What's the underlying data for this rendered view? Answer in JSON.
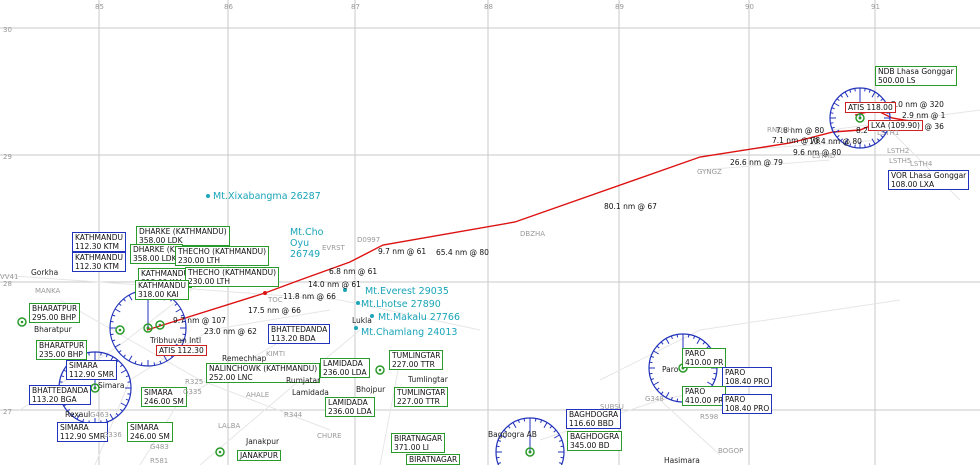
{
  "grid": {
    "lon": [
      "85",
      "86",
      "87",
      "88",
      "89",
      "90",
      "91"
    ],
    "lat": [
      "30",
      "29",
      "28",
      "27"
    ]
  },
  "route_legs": [
    "80.1 nm @ 67",
    "65.4 nm @ 80",
    "26.6 nm @ 79",
    "9.7 nm @ 61",
    "6.8 nm @ 61",
    "14.0 nm @ 61",
    "11.8 nm @ 66",
    "17.5 nm @ 66",
    "9.7 nm @ 107",
    "23.0 nm @ 62",
    "7.1 nm @ 78",
    "7.8 nm @ 80",
    "9.6 nm @ 80",
    "10.4 nm @ 80",
    "8.2",
    "3.0 nm @ 320",
    "2.9 nm @ 1",
    "nm @ 36"
  ],
  "peaks": [
    {
      "name": "Mt.Xixabangma 26287"
    },
    {
      "name": "Mt.Cho\nOyu\n26749"
    },
    {
      "name": "Mt.Everest 29035"
    },
    {
      "name": "Mt.Lhotse 27890"
    },
    {
      "name": "Mt.Makalu 27766"
    },
    {
      "name": "Mt.Chamlang 24013"
    }
  ],
  "boxes": [
    {
      "text": "NDB Lhasa Gonggar\n500.00 LS",
      "color": "g"
    },
    {
      "text": "ATIS 118.00",
      "color": "r"
    },
    {
      "text": "LXA (109.90)",
      "color": "r"
    },
    {
      "text": "VOR Lhasa Gonggar\n108.00 LXA",
      "color": "b"
    },
    {
      "text": "KATHMANDU\n112.30 KTM",
      "color": "b"
    },
    {
      "text": "KATHMANDU\n112.30 KTM",
      "color": "b"
    },
    {
      "text": "DHARKE (KATHMANDU)\n358.00 LDK",
      "color": "g"
    },
    {
      "text": "DHARKE (KA\n358.00 LDK",
      "color": "g"
    },
    {
      "text": "THECHO (KATHMANDU)\n230.00 LTH",
      "color": "g"
    },
    {
      "text": "KATHMANDU\n318.00 KAI",
      "color": "g"
    },
    {
      "text": "THECHO (KATHMANDU)\n230.00 LTH",
      "color": "g"
    },
    {
      "text": "KATHMANDU\n318.00 KAI",
      "color": "g"
    },
    {
      "text": "BHARATPUR\n295.00 BHP",
      "color": "g"
    },
    {
      "text": "BHARATPUR\n235.00 BHP",
      "color": "g"
    },
    {
      "text": "ATIS 112.30",
      "color": "r"
    },
    {
      "text": "BHATTEDANDA\n113.20 BDA",
      "color": "b"
    },
    {
      "text": "SIMARA\n112.90 SMR",
      "color": "b"
    },
    {
      "text": "BHATTEDANDA\n113.20 BGA",
      "color": "b"
    },
    {
      "text": "SIMARA\n246.00 SM",
      "color": "g"
    },
    {
      "text": "SIMARA\n112.90 SMR",
      "color": "b"
    },
    {
      "text": "SIMARA\n246.00 SM",
      "color": "g"
    },
    {
      "text": "NALINCHOWK (KATHMANDU)\n252.00 LNC",
      "color": "g"
    },
    {
      "text": "LAMIDADA\n236.00 LDA",
      "color": "g"
    },
    {
      "text": "LAMIDADA\n236.00 LDA",
      "color": "g"
    },
    {
      "text": "TUMLINGTAR\n227.00 TTR",
      "color": "g"
    },
    {
      "text": "TUMLINGTAR\n227.00 TTR",
      "color": "g"
    },
    {
      "text": "BIRATNAGAR\n371.00 LI",
      "color": "g"
    },
    {
      "text": "BIRATNAGAR",
      "color": "g"
    },
    {
      "text": "JANAKPUR",
      "color": "g"
    },
    {
      "text": "PARO\n410.00 PR",
      "color": "g"
    },
    {
      "text": "PARO\n108.40 PRO",
      "color": "b"
    },
    {
      "text": "PARO\n410.00 PR",
      "color": "g"
    },
    {
      "text": "PARO\n108.40 PRO",
      "color": "b"
    },
    {
      "text": "BAGHDOGRA\n116.60 BBD",
      "color": "b"
    },
    {
      "text": "BAGHDOGRA\n345.00 BD",
      "color": "g"
    }
  ],
  "towns": [
    "Gorkha",
    "Bharatpur",
    "Simara",
    "Rexaul",
    "Remechhap",
    "Rumjatar",
    "Lamidada",
    "Bhojpur",
    "Tumlingtar",
    "Lukla",
    "Janakpur",
    "Paro",
    "Bagdogra AB",
    "Hasimara",
    "Tribhuvan Intl"
  ],
  "fixes": [
    "RNOCH",
    "GYNGZ",
    "DBZHA",
    "EVRST",
    "D0997",
    "LSTHD",
    "LSTH1",
    "LSTH2",
    "LSTH5",
    "LSTH4",
    "VV41",
    "MANKA",
    "R325",
    "G335",
    "R344",
    "G463",
    "G336",
    "G483",
    "R581",
    "R598",
    "G348",
    "AHALE",
    "CHURE",
    "LALBA",
    "KIMTI",
    "SUBSU",
    "BOGOP",
    "TOC"
  ]
}
